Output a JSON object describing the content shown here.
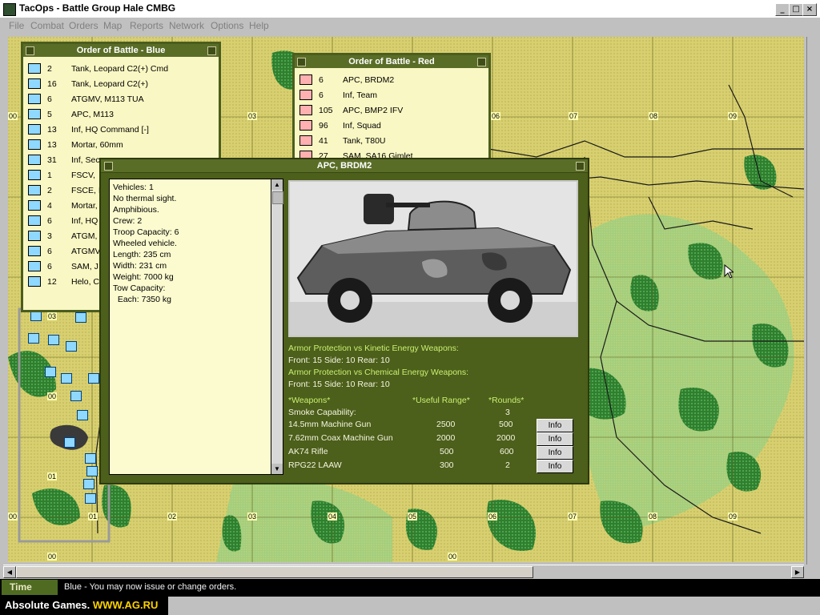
{
  "window": {
    "title": "TacOps - Battle Group Hale CMBG"
  },
  "menu": [
    "File",
    "Combat",
    "Orders",
    "Map",
    "Reports",
    "Network",
    "Options",
    "Help"
  ],
  "map": {
    "hex_labels_top": [
      "00",
      "03",
      "06",
      "07",
      "08",
      "09"
    ],
    "hex_labels_bottom": [
      "00",
      "01",
      "02",
      "03",
      "04",
      "05",
      "06",
      "07",
      "08",
      "09"
    ],
    "hex_labels_left": [
      "03",
      "00",
      "01"
    ],
    "footer_labels": [
      "00",
      "00"
    ]
  },
  "oob_blue": {
    "title": "Order of Battle - Blue",
    "rows": [
      {
        "num": "2",
        "name": "Tank, Leopard C2(+) Cmd"
      },
      {
        "num": "16",
        "name": "Tank, Leopard C2(+)"
      },
      {
        "num": "6",
        "name": "ATGMV, M113 TUA"
      },
      {
        "num": "5",
        "name": "APC, M113"
      },
      {
        "num": "13",
        "name": "Inf, HQ Command [-]"
      },
      {
        "num": "13",
        "name": "Mortar, 60mm"
      },
      {
        "num": "31",
        "name": "Inf, Sec"
      },
      {
        "num": "1",
        "name": "FSCV,"
      },
      {
        "num": "2",
        "name": "FSCE, I"
      },
      {
        "num": "4",
        "name": "Mortar,"
      },
      {
        "num": "6",
        "name": "Inf, HQ"
      },
      {
        "num": "3",
        "name": "ATGM,"
      },
      {
        "num": "6",
        "name": "ATGMV"
      },
      {
        "num": "6",
        "name": "SAM, J"
      },
      {
        "num": "12",
        "name": "Helo, C"
      }
    ]
  },
  "oob_red": {
    "title": "Order of Battle - Red",
    "rows": [
      {
        "num": "6",
        "name": "APC, BRDM2"
      },
      {
        "num": "6",
        "name": "Inf, Team"
      },
      {
        "num": "105",
        "name": "APC, BMP2 IFV"
      },
      {
        "num": "96",
        "name": "Inf, Squad"
      },
      {
        "num": "41",
        "name": "Tank, T80U"
      },
      {
        "num": "27",
        "name": "SAM, SA16 Gimlet"
      }
    ]
  },
  "detail": {
    "title": "APC, BRDM2",
    "specs": [
      "Vehicles: 1",
      "No thermal sight.",
      "Amphibious.",
      "Crew: 2",
      "Troop Capacity: 6",
      "Wheeled vehicle.",
      "Length: 235 cm",
      "Width: 231 cm",
      "Weight: 7000 kg",
      "Tow Capacity:",
      "  Each: 7350 kg"
    ],
    "armor_kinetic_label": "Armor Protection vs Kinetic Energy Weapons:",
    "armor_kinetic_value": "Front: 15 Side: 10 Rear: 10",
    "armor_chemical_label": "Armor Protection vs Chemical Energy Weapons:",
    "armor_chemical_value": "Front: 15 Side: 10 Rear: 10",
    "weapons_header": {
      "weapons": "*Weapons*",
      "range": "*Useful Range*",
      "rounds": "*Rounds*"
    },
    "smoke": {
      "label": "Smoke Capability:",
      "rounds": "3"
    },
    "weapons": [
      {
        "name": "14.5mm Machine Gun",
        "range": "2500",
        "rounds": "500",
        "button": "Info"
      },
      {
        "name": "7.62mm Coax Machine Gun",
        "range": "2000",
        "rounds": "2000",
        "button": "Info"
      },
      {
        "name": "AK74 Rifle",
        "range": "500",
        "rounds": "600",
        "button": "Info"
      },
      {
        "name": "RPG22 LAAW",
        "range": "300",
        "rounds": "2",
        "button": "Info"
      }
    ]
  },
  "status": {
    "time_label": "Time",
    "message": "Blue - You may now issue or change orders."
  },
  "watermark": {
    "prefix": "Absolute Games.",
    "url": "WWW.AG.RU"
  },
  "colors": {
    "panel_green": "#4c5f1b",
    "map_yellow": "#d8d070",
    "forest_green": "#3e8f3e",
    "label_green": "#c9f070"
  }
}
